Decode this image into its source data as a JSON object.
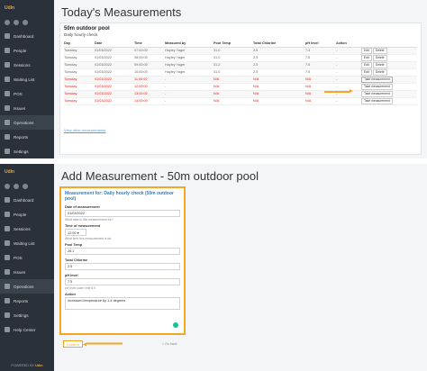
{
  "colors": {
    "accent": "#f5a623",
    "sidebar": "#2b3138",
    "missed": "#e2231a",
    "link": "#4aa3df"
  },
  "sidebar1": {
    "brand": "Udin",
    "items": [
      {
        "label": "Dashboard",
        "icon": "dashboard-icon"
      },
      {
        "label": "People",
        "icon": "people-icon"
      },
      {
        "label": "Sessions",
        "icon": "sessions-icon"
      },
      {
        "label": "Waiting List",
        "icon": "waiting-list-icon"
      },
      {
        "label": "POS",
        "icon": "pos-icon"
      },
      {
        "label": "Issues",
        "icon": "issues-icon"
      },
      {
        "label": "Operations",
        "icon": "operations-icon"
      },
      {
        "label": "Reports",
        "icon": "reports-icon"
      },
      {
        "label": "Settings",
        "icon": "settings-icon"
      }
    ]
  },
  "screen1": {
    "title": "Today's Measurements",
    "pool_name": "50m outdoor pool",
    "check_name": "Daily hourly check",
    "columns": [
      "Day",
      "Date",
      "Time",
      "Measured by",
      "Pool Temp",
      "Total Chlorine",
      "pH level",
      "Action"
    ],
    "rows": [
      {
        "day": "Tuesday",
        "date": "01/03/2022",
        "time": "07:00:00",
        "by": "Hayley Yager",
        "temp": "31.0",
        "chlorine": "2.5",
        "ph": "7.4",
        "action": "-",
        "buttons": [
          "Edit",
          "Delete"
        ],
        "missed": false
      },
      {
        "day": "Tuesday",
        "date": "01/03/2022",
        "time": "08:00:00",
        "by": "Hayley Yager",
        "temp": "31.0",
        "chlorine": "2.5",
        "ph": "7.5",
        "action": "-",
        "buttons": [
          "Edit",
          "Delete"
        ],
        "missed": false
      },
      {
        "day": "Tuesday",
        "date": "01/03/2022",
        "time": "09:00:00",
        "by": "Hayley Yager",
        "temp": "31.2",
        "chlorine": "2.5",
        "ph": "7.5",
        "action": "-",
        "buttons": [
          "Edit",
          "Delete"
        ],
        "missed": false
      },
      {
        "day": "Tuesday",
        "date": "01/03/2022",
        "time": "10:00:00",
        "by": "Hayley Yager",
        "temp": "31.0",
        "chlorine": "2.5",
        "ph": "7.5",
        "action": "-",
        "buttons": [
          "Edit",
          "Delete"
        ],
        "missed": false
      },
      {
        "day": "Tuesday",
        "date": "01/03/2022",
        "time": "11:00:00",
        "by": "-",
        "temp": "N/A",
        "chlorine": "N/A",
        "ph": "N/A",
        "action": "-",
        "buttons": [
          "Take measurement"
        ],
        "missed": true
      },
      {
        "day": "Tuesday",
        "date": "01/03/2022",
        "time": "12:00:00",
        "by": "-",
        "temp": "N/A",
        "chlorine": "N/A",
        "ph": "N/A",
        "action": "-",
        "buttons": [
          "Take measurement"
        ],
        "missed": true
      },
      {
        "day": "Tuesday",
        "date": "01/03/2022",
        "time": "13:00:00",
        "by": "-",
        "temp": "N/A",
        "chlorine": "N/A",
        "ph": "N/A",
        "action": "-",
        "buttons": [
          "Take measurement"
        ],
        "missed": true
      },
      {
        "day": "Tuesday",
        "date": "01/03/2022",
        "time": "14:00:00",
        "by": "-",
        "temp": "N/A",
        "chlorine": "N/A",
        "ph": "N/A",
        "action": "-",
        "buttons": [
          "Take measurement"
        ],
        "missed": true
      }
    ],
    "view_other_link": "View other measurements"
  },
  "sidebar2": {
    "brand": "Udin",
    "items": [
      {
        "label": "Dashboard",
        "icon": "dashboard-icon"
      },
      {
        "label": "People",
        "icon": "people-icon"
      },
      {
        "label": "Sessions",
        "icon": "sessions-icon"
      },
      {
        "label": "Waiting List",
        "icon": "waiting-list-icon"
      },
      {
        "label": "POS",
        "icon": "pos-icon"
      },
      {
        "label": "Issues",
        "icon": "issues-icon"
      },
      {
        "label": "Operations",
        "icon": "operations-icon"
      },
      {
        "label": "Reports",
        "icon": "reports-icon"
      },
      {
        "label": "Settings",
        "icon": "settings-icon"
      },
      {
        "label": "Help Center",
        "icon": "help-icon"
      }
    ],
    "footer_prefix": "POWERED BY",
    "footer_brand": "Udin"
  },
  "screen2": {
    "title": "Add Measurement - 50m outdoor pool",
    "form_title": "Measurement for: Daily hourly check (50m outdoor pool)",
    "fields": {
      "date_label": "Date of measurement",
      "date_value": "01/03/2022",
      "date_help": "What date is this measurement for?",
      "time_label": "Time of measurement",
      "time_value": "12:00",
      "time_help": "What time this measurement is for",
      "temp_label": "Pool Temp",
      "temp_value": "28.1",
      "chlorine_label": "Total Chlorine",
      "chlorine_value": "2.5",
      "ph_label": "pH level",
      "ph_value": "7.5",
      "ph_help": "pH level lower limit 6.5",
      "action_label": "Action",
      "action_value": "increased temperature by 1.4 degrees"
    },
    "confirm_label": "Confirm",
    "go_back_label": "< Go back"
  }
}
